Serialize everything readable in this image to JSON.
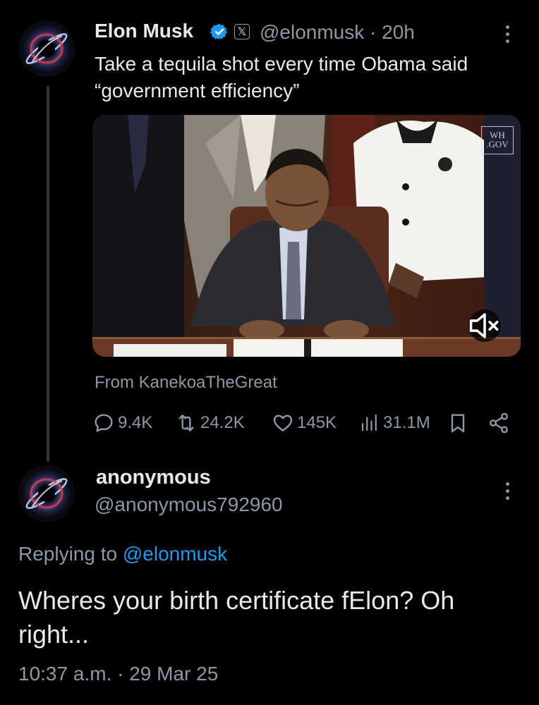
{
  "tweet": {
    "author_name": "Elon Musk",
    "author_handle": "@elonmusk",
    "time_ago": "20h",
    "text": "Take a tequila shot every time Obama said “government efficiency”",
    "media_watermark": "WH\n.GOV",
    "source": "From KanekoaTheGreat",
    "stats": {
      "replies": "9.4K",
      "reposts": "24.2K",
      "likes": "145K",
      "views": "31.1M"
    }
  },
  "reply": {
    "author_name": "anonymous",
    "author_handle": "@anonymous792960",
    "replying_prefix": "Replying to",
    "replying_to": "@elonmusk",
    "text": "Wheres your birth certificate fElon? Oh right...",
    "timestamp": "10:37 a.m.",
    "date": "29 Mar 25"
  },
  "colors": {
    "background": "#000000",
    "text_primary": "#e7e9ea",
    "text_secondary": "#8b98a5",
    "accent": "#1d9bf0",
    "thread_line": "#333639"
  },
  "icons": {
    "avatar": "blackhole-avatar",
    "verified": "verified-badge-icon",
    "affiliate": "x-logo-icon",
    "more": "more-vertical-icon",
    "mute": "speaker-muted-icon",
    "reply": "reply-icon",
    "repost": "repost-icon",
    "like": "heart-icon",
    "views": "views-icon",
    "bookmark": "bookmark-icon",
    "share": "share-icon"
  }
}
